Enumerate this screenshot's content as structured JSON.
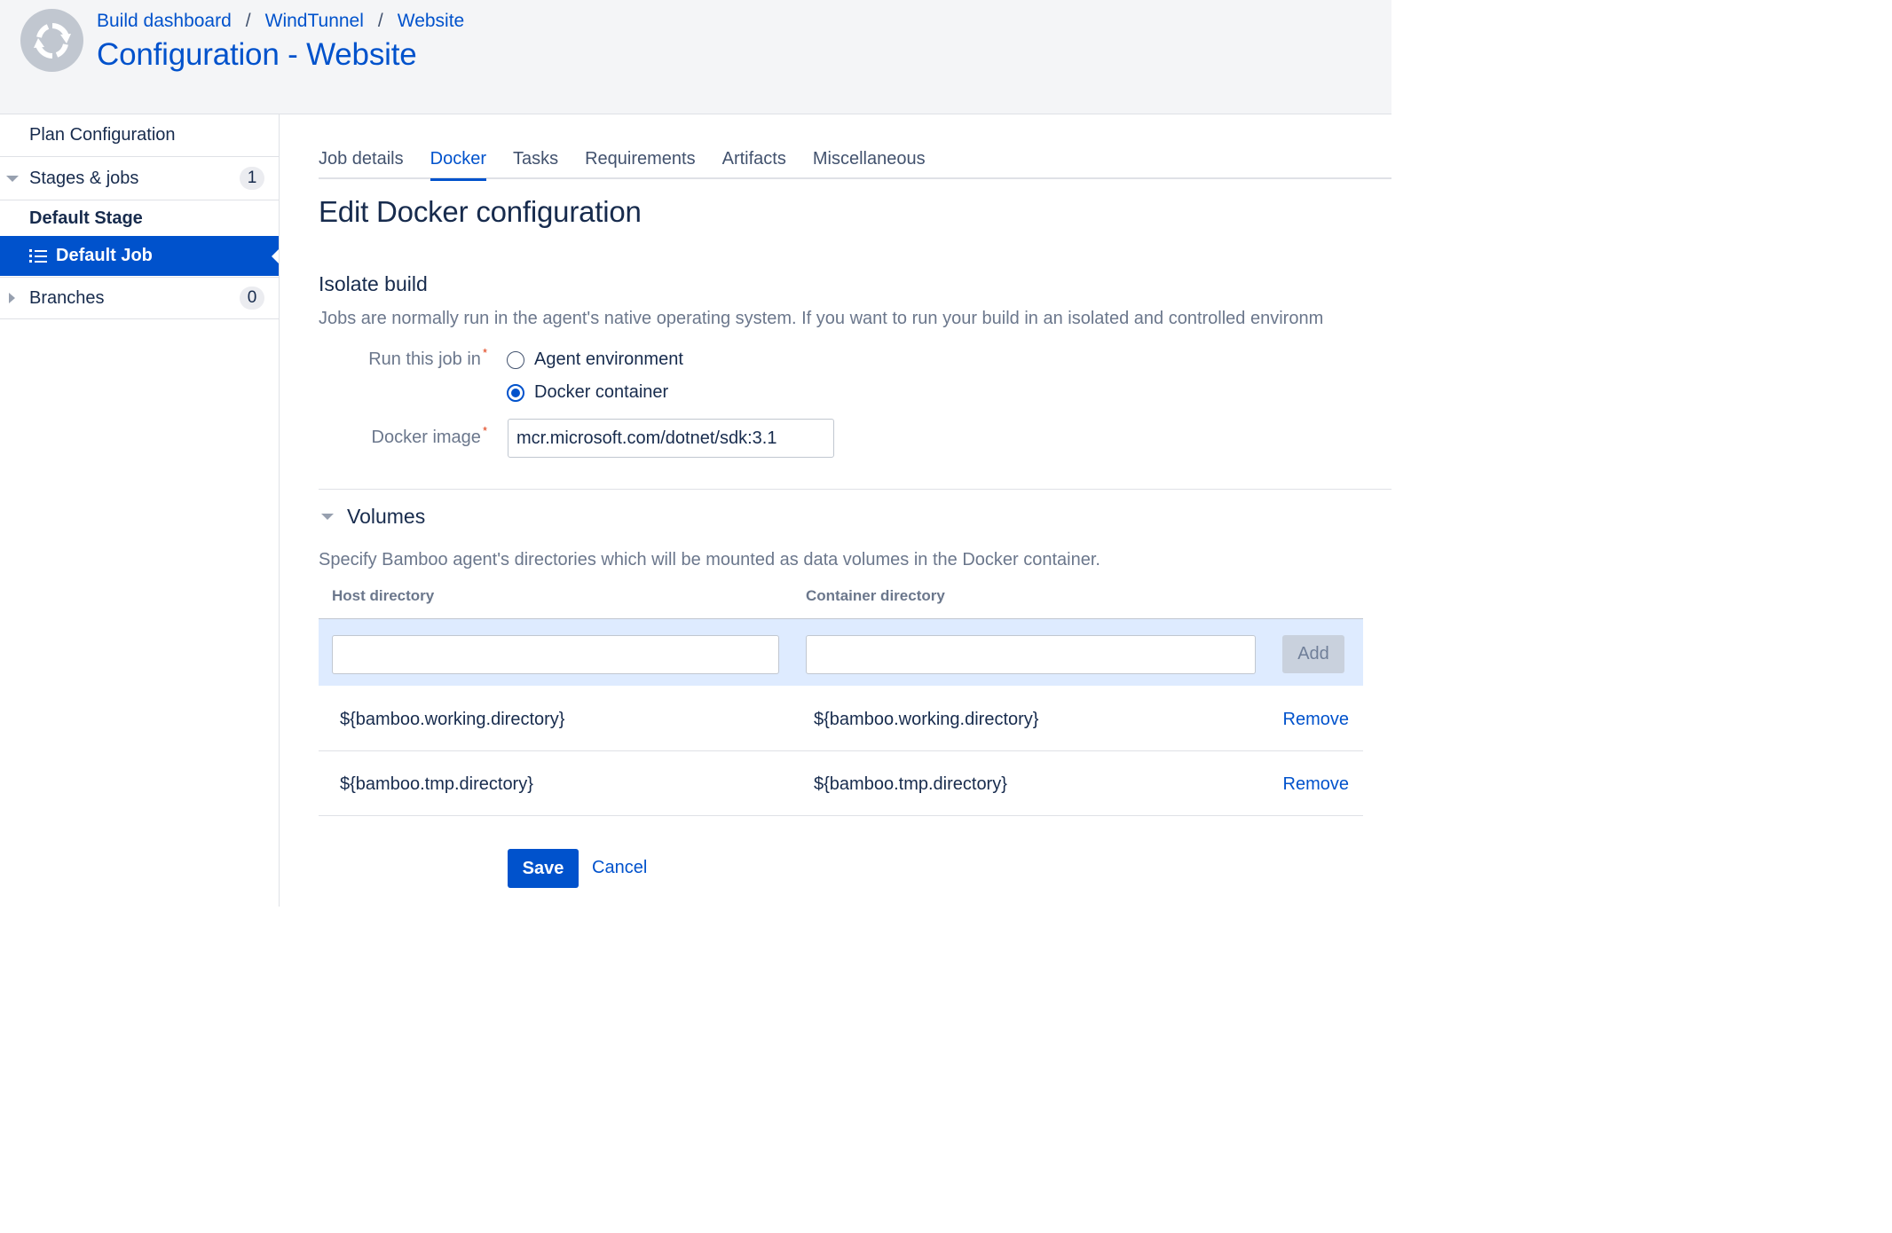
{
  "breadcrumb": {
    "items": [
      "Build dashboard",
      "WindTunnel",
      "Website"
    ],
    "separator": "/"
  },
  "page_title": "Configuration - Website",
  "sidebar": {
    "plan_configuration": "Plan Configuration",
    "stages_label": "Stages & jobs",
    "stages_count": "1",
    "stage_name": "Default Stage",
    "job_name": "Default Job",
    "branches_label": "Branches",
    "branches_count": "0"
  },
  "tabs": [
    {
      "label": "Job details",
      "active": false
    },
    {
      "label": "Docker",
      "active": true
    },
    {
      "label": "Tasks",
      "active": false
    },
    {
      "label": "Requirements",
      "active": false
    },
    {
      "label": "Artifacts",
      "active": false
    },
    {
      "label": "Miscellaneous",
      "active": false
    }
  ],
  "content": {
    "heading": "Edit Docker configuration",
    "isolate_heading": "Isolate build",
    "isolate_description": "Jobs are normally run in the agent's native operating system. If you want to run your build in an isolated and controlled environm",
    "run_label": "Run this job in",
    "required_marker": "*",
    "run_options": [
      {
        "label": "Agent environment",
        "selected": false
      },
      {
        "label": "Docker container",
        "selected": true
      }
    ],
    "image_label": "Docker image",
    "image_value": "mcr.microsoft.com/dotnet/sdk:3.1",
    "volumes_heading": "Volumes",
    "volumes_description": "Specify Bamboo agent's directories which will be mounted as data volumes in the Docker container.",
    "columns": {
      "host": "Host directory",
      "container": "Container directory"
    },
    "add_label": "Add",
    "remove_label": "Remove",
    "volumes": [
      {
        "host": "${bamboo.working.directory}",
        "container": "${bamboo.working.directory}"
      },
      {
        "host": "${bamboo.tmp.directory}",
        "container": "${bamboo.tmp.directory}"
      }
    ],
    "save_label": "Save",
    "cancel_label": "Cancel"
  },
  "icons": {
    "plan_avatar": "refresh-cycle-icon",
    "job": "list-icon",
    "expand": "chevron-down-icon",
    "collapse": "chevron-right-icon"
  },
  "colors": {
    "accent": "#0052cc",
    "header_bg": "#f4f5f7",
    "add_row_bg": "#deebff",
    "required": "#de350b"
  }
}
